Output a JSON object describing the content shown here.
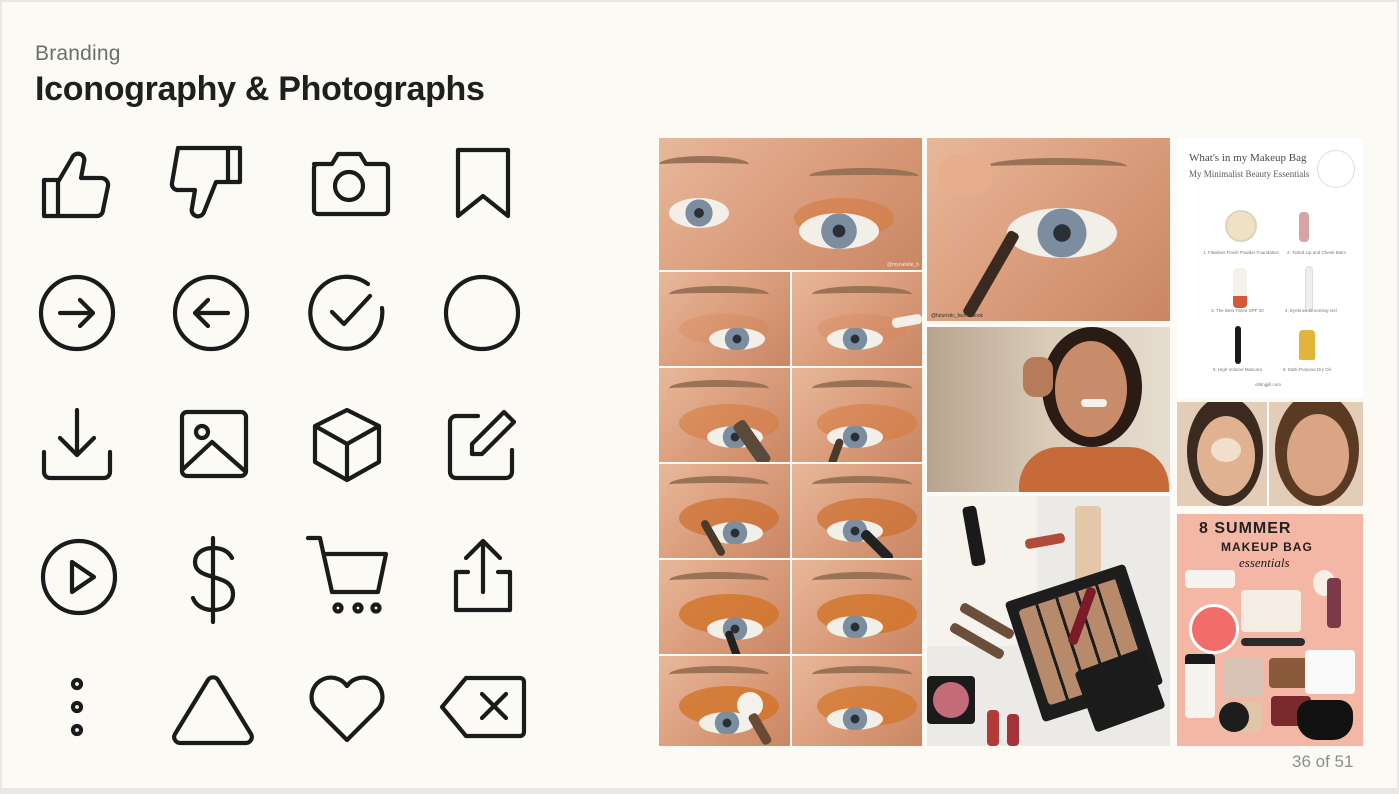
{
  "header": {
    "section_label": "Branding",
    "title": "Iconography & Photographs"
  },
  "icons": [
    {
      "name": "thumbs-up-icon"
    },
    {
      "name": "thumbs-down-icon"
    },
    {
      "name": "camera-icon"
    },
    {
      "name": "bookmark-icon"
    },
    {
      "name": "arrow-right-circle-icon"
    },
    {
      "name": "arrow-left-circle-icon"
    },
    {
      "name": "check-circle-icon"
    },
    {
      "name": "circle-icon"
    },
    {
      "name": "download-icon"
    },
    {
      "name": "image-icon"
    },
    {
      "name": "package-box-icon"
    },
    {
      "name": "edit-pencil-icon"
    },
    {
      "name": "play-circle-icon"
    },
    {
      "name": "dollar-sign-icon"
    },
    {
      "name": "shopping-cart-icon"
    },
    {
      "name": "upload-share-icon"
    },
    {
      "name": "more-vertical-icon"
    },
    {
      "name": "triangle-icon"
    },
    {
      "name": "heart-icon"
    },
    {
      "name": "backspace-delete-icon"
    }
  ],
  "photos": {
    "infographic": {
      "title": "What's in my Makeup Bag",
      "subtitle": "My Minimalist Beauty Essentials",
      "captions": [
        "1. Flawless Finish Powder Foundation",
        "2. Tinted Lip and Cheek Balm",
        "3. The Best Tinted SPF 30",
        "4. Eyebrow Grooming Gel",
        "5. High Volume Mascara",
        "6. Multi-Purpose Dry Oil"
      ],
      "footer": "ohtingjill.com"
    },
    "summer_poster": {
      "line1": "8 SUMMER",
      "line2": "MAKEUP BAG",
      "line3": "essentials"
    }
  },
  "footer": {
    "page_indicator": "36 of 51"
  },
  "colors": {
    "background": "#fbfaf5",
    "icon_stroke": "#1b1b1b",
    "title": "#1f1f1f",
    "poster_pink": "#f4b7a6"
  }
}
